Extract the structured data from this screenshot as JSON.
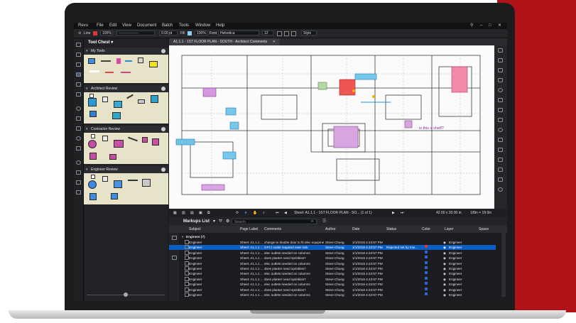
{
  "app": {
    "menu": [
      "Revu",
      "File",
      "Edit",
      "View",
      "Document",
      "Batch",
      "Tools",
      "Window",
      "Help"
    ]
  },
  "toolbar": {
    "line_label": "Line",
    "opacity1": "100%",
    "thickness": "0.00 pt",
    "fill_label": "Fill",
    "opacity2": "100%",
    "font_label": "Font",
    "font_value": "Helvetica",
    "font_size": "12",
    "style_label": "Style",
    "line_color": "#d83a3a",
    "fill_color": "#8fd0f0"
  },
  "toolchest": {
    "title": "Tool Chest",
    "sections": [
      {
        "label": "My Tools"
      },
      {
        "label": "Architect Review"
      },
      {
        "label": "Contractor Review"
      },
      {
        "label": "Engineer Review"
      }
    ]
  },
  "viewer": {
    "tab_title": "A1.1.1 - 1ST FLOOR PLAN - SOUTH - Architect Comments",
    "annotation_text": "is this a shelf?"
  },
  "navbar": {
    "sheet": "Sheet: A1.1.1 - 1ST FLOOR PLAN - SO... (1 of 1)",
    "dims": "42.00 x 30.00 in",
    "scale": "1/8in = 1ft 0in"
  },
  "markups": {
    "title": "Markups List",
    "search_placeholder": "Search",
    "columns": [
      "Subject",
      "Page Label",
      "Comments",
      "Author",
      "Date",
      "Status",
      "Color",
      "Layer",
      "Space"
    ],
    "group_label": "Engineer (7)",
    "rows": [
      {
        "subject": "Engineer",
        "page": "Sheet: A1.1.1 ...",
        "comment": "change to double door to fit elec equipment",
        "author": "Steve Chung",
        "date": "1/1/2016 4:43:57 PM",
        "status": "",
        "color": "",
        "layer": "Engineer",
        "selected": false
      },
      {
        "subject": "Engineer",
        "page": "Sheet: A1.1.1 ...",
        "comment": "GFCI outlet required near sink",
        "author": "Steve Chung",
        "date": "1/1/2016 4:43:57 PM",
        "status": "Rejected set by Inw...",
        "color": "#d83a3a",
        "layer": "Engineer",
        "selected": true
      },
      {
        "subject": "Engineer",
        "page": "Sheet: A1.1.1 ...",
        "comment": "elec outlets needed on columns",
        "author": "Steve Chung",
        "date": "1/1/2016 4:43:57 PM",
        "status": "",
        "color": "#2f63d8",
        "layer": "Engineer",
        "selected": false
      },
      {
        "subject": "Engineer",
        "page": "Sheet: A1.1.1 ...",
        "comment": "does planter need sprinkles?",
        "author": "Steve Chung",
        "date": "1/1/2016 4:43:57 PM",
        "status": "",
        "color": "#2f63d8",
        "layer": "Engineer",
        "selected": false
      },
      {
        "subject": "Engineer",
        "page": "Sheet: A1.1.1 ...",
        "comment": "elec outlets needed on columns",
        "author": "Steve Chung",
        "date": "1/1/2016 4:43:57 PM",
        "status": "",
        "color": "#2f63d8",
        "layer": "Engineer",
        "selected": false
      },
      {
        "subject": "Engineer",
        "page": "Sheet: A1.1.1 ...",
        "comment": "does planter need sprinkles?",
        "author": "Steve Chung",
        "date": "1/1/2016 4:43:57 PM",
        "status": "",
        "color": "#2f63d8",
        "layer": "Engineer",
        "selected": false
      },
      {
        "subject": "Engineer",
        "page": "Sheet: A1.1.1 ...",
        "comment": "elec outlets needed on columns",
        "author": "Steve Chung",
        "date": "1/1/2016 4:43:57 PM",
        "status": "",
        "color": "#2f63d8",
        "layer": "Engineer",
        "selected": false
      },
      {
        "subject": "Engineer",
        "page": "Sheet: A1.1.1 ...",
        "comment": "does planter need sprinkles?",
        "author": "Steve Chung",
        "date": "1/1/2016 4:43:57 PM",
        "status": "",
        "color": "#2f63d8",
        "layer": "Engineer",
        "selected": false
      },
      {
        "subject": "Engineer",
        "page": "Sheet: A1.1.1 ...",
        "comment": "elec outlets needed on columns",
        "author": "Steve Chung",
        "date": "1/1/2016 4:43:57 PM",
        "status": "",
        "color": "#2f63d8",
        "layer": "Engineer",
        "selected": false
      },
      {
        "subject": "Engineer",
        "page": "Sheet: A1.1.1 ...",
        "comment": "does planter need sprinkles?",
        "author": "Steve Chung",
        "date": "1/1/2016 4:43:57 PM",
        "status": "",
        "color": "#2f63d8",
        "layer": "Engineer",
        "selected": false
      },
      {
        "subject": "Engineer",
        "page": "Sheet: A1.1.1 ...",
        "comment": "elec outlets needed on columns",
        "author": "Steve Chung",
        "date": "1/1/2016 4:43:57 PM",
        "status": "",
        "color": "#2f63d8",
        "layer": "Engineer",
        "selected": false
      }
    ]
  }
}
